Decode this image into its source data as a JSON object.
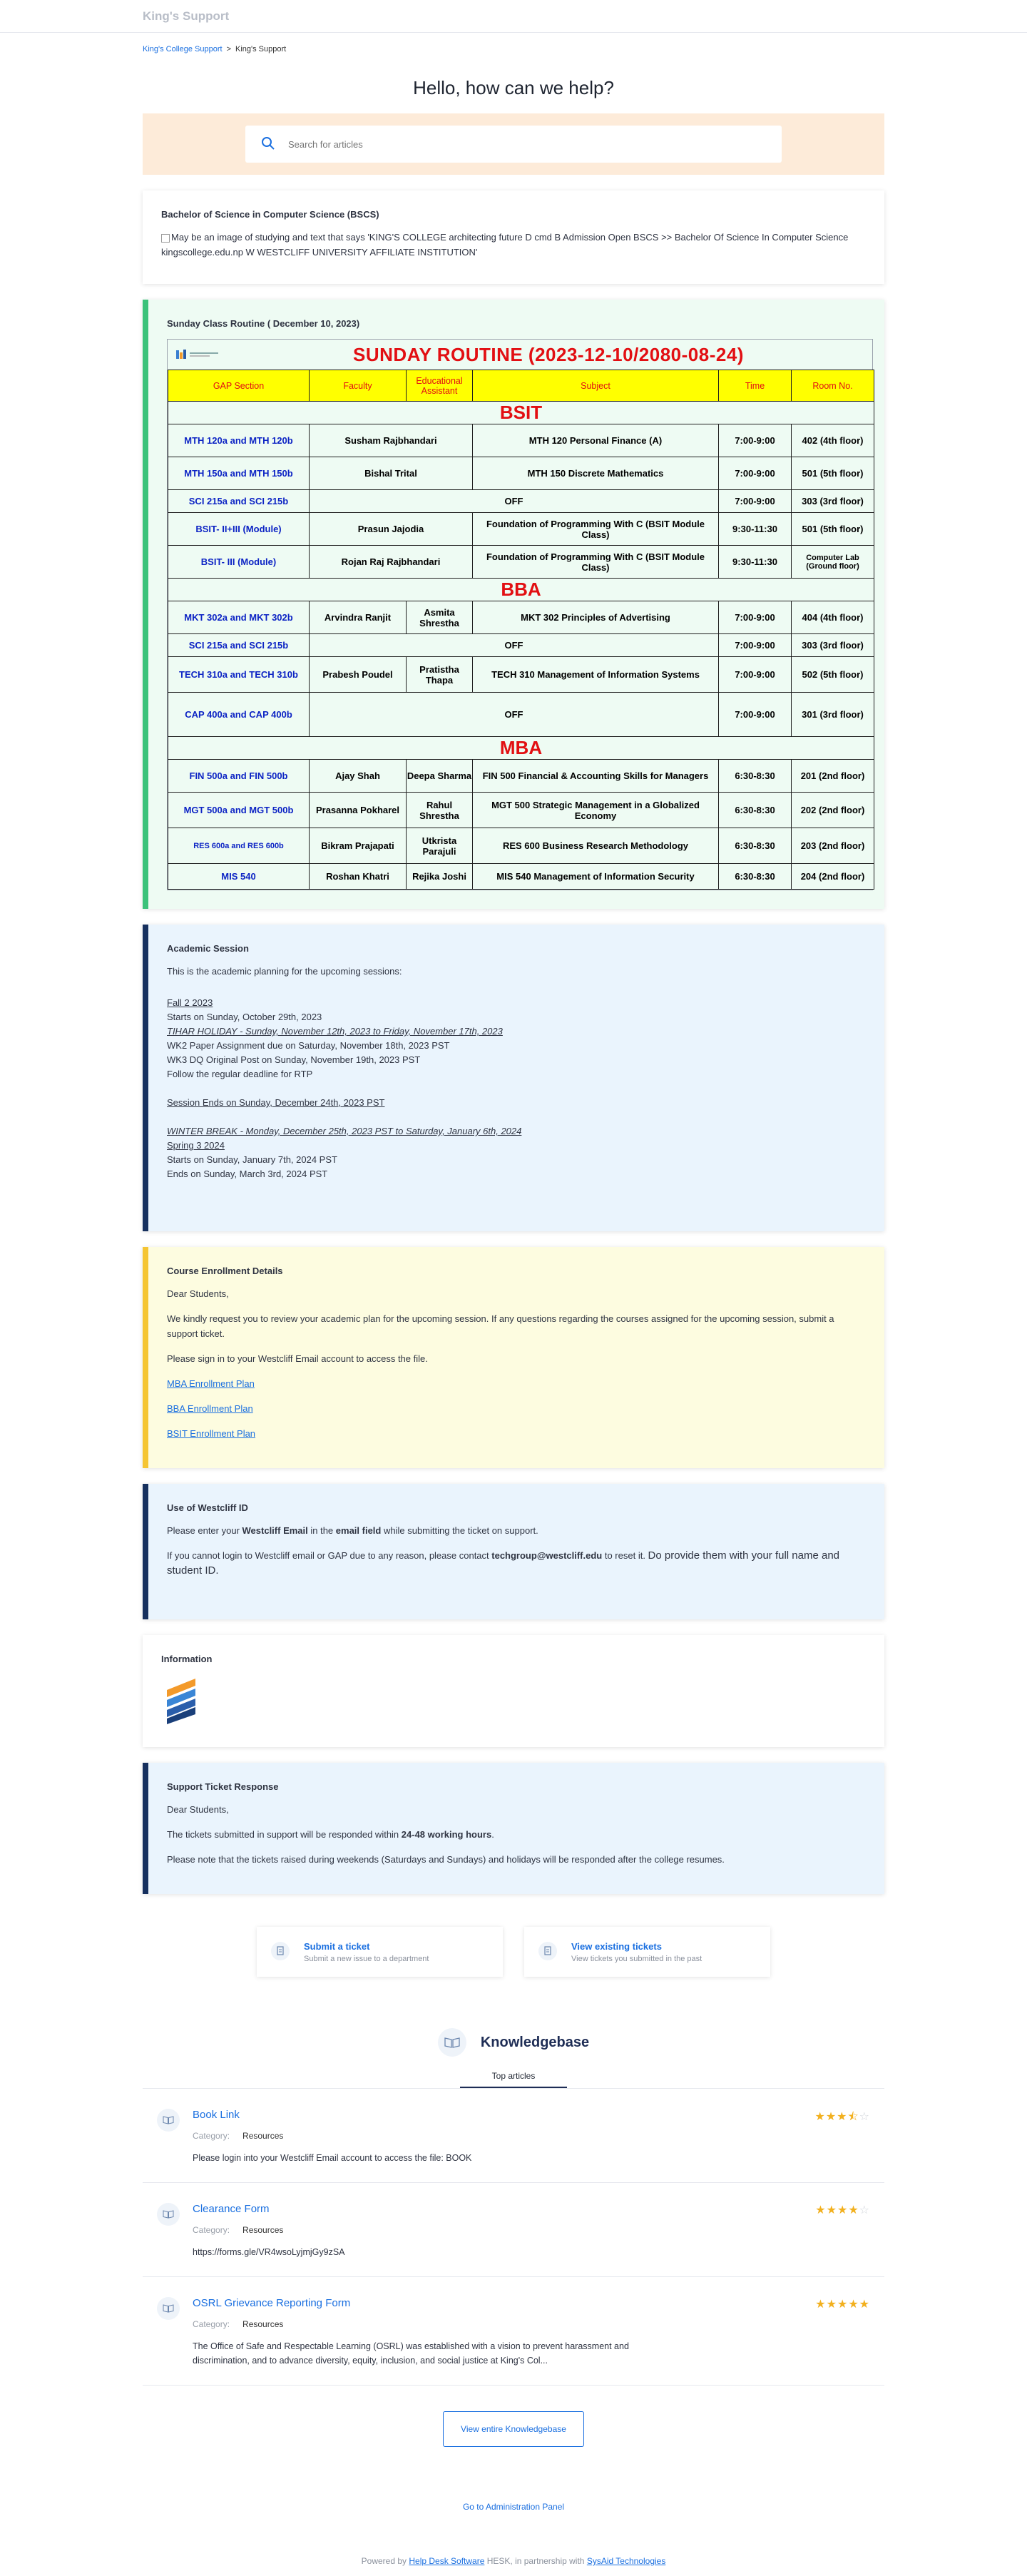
{
  "header": {
    "brand": "King's Support"
  },
  "breadcrumb": {
    "parent": "King's College Support",
    "separator": ">",
    "current": "King's Support"
  },
  "hero": {
    "title": "Hello, how can we help?"
  },
  "search": {
    "placeholder": "Search for articles"
  },
  "bscs": {
    "title": "Bachelor of Science in Computer Science (BSCS)",
    "image_alt": "May be an image of studying and text that says 'KING'S COLLEGE architecting future D cmd B Admission Open BSCS >> Bachelor Of Science In Computer Science kingscollege.edu.np W WESTCLIFF UNIVERSITY AFFILIATE INSTITUTION'"
  },
  "routine": {
    "card_title": "Sunday Class Routine ( December 10, 2023)",
    "banner": "SUNDAY  ROUTINE (2023-12-10/2080-08-24)",
    "headers": [
      "GAP Section",
      "Faculty",
      "Educational Assistant",
      "Subject",
      "Time",
      "Room No."
    ],
    "sections": {
      "bsit": "BSIT",
      "bba": "BBA",
      "mba": "MBA"
    },
    "rows": [
      [
        "MTH 120a and MTH 120b",
        "Susham Rajbhandari",
        "MTH 120 Personal Finance (A)",
        "7:00-9:00",
        "402 (4th floor)"
      ],
      [
        "MTH 150a and MTH 150b",
        "Bishal Trital",
        "MTH 150 Discrete Mathematics",
        "7:00-9:00",
        "501 (5th floor)"
      ],
      [
        "SCI 215a and SCI 215b",
        "OFF",
        "7:00-9:00",
        "303 (3rd floor)"
      ],
      [
        "BSIT-  II+III (Module)",
        "Prasun Jajodia",
        "Foundation of Programming With C (BSIT Module Class)",
        "9:30-11:30",
        "501 (5th floor)"
      ],
      [
        "BSIT-  III (Module)",
        "Rojan Raj Rajbhandari",
        "Foundation of Programming With C (BSIT Module Class)",
        "9:30-11:30",
        "Computer Lab (Ground  floor)"
      ],
      [
        "MKT 302a and MKT 302b",
        "Arvindra Ranjit",
        "Asmita Shrestha",
        "MKT 302 Principles of Advertising",
        "7:00-9:00",
        "404 (4th floor)"
      ],
      [
        "SCI 215a and SCI 215b",
        "OFF",
        "7:00-9:00",
        "303 (3rd floor)"
      ],
      [
        "TECH 310a and TECH 310b",
        "Prabesh Poudel",
        "Pratistha Thapa",
        "TECH 310 Management of Information Systems",
        "7:00-9:00",
        "502 (5th floor)"
      ],
      [
        "CAP 400a and CAP 400b",
        "OFF",
        "7:00-9:00",
        "301 (3rd floor)"
      ],
      [
        "FIN 500a and  FIN 500b",
        "Ajay Shah",
        "Deepa Sharma",
        "FIN 500 Financial & Accounting Skills for Managers",
        "6:30-8:30",
        "201 (2nd floor)"
      ],
      [
        "MGT 500a and  MGT 500b",
        "Prasanna Pokharel",
        "Rahul Shrestha",
        "MGT 500 Strategic Management in a Globalized Economy",
        "6:30-8:30",
        "202 (2nd floor)"
      ],
      [
        "RES 600a and RES 600b",
        "Bikram Prajapati",
        "Utkrista Parajuli",
        "RES 600 Business Research Methodology",
        "6:30-8:30",
        "203 (2nd floor)"
      ],
      [
        "MIS 540",
        "Roshan Khatri",
        "Rejika Joshi",
        "MIS 540 Management of Information Security",
        "6:30-8:30",
        "204 (2nd floor)"
      ]
    ]
  },
  "academic": {
    "title": "Academic Session",
    "intro": "This is the academic planning for the upcoming sessions:",
    "fall_title": "Fall 2 2023",
    "fall_start": "Starts on Sunday, October 29th, 2023",
    "tihar": "TIHAR HOLIDAY - Sunday, November 12th, 2023 to Friday, November 17th, 2023",
    "wk2": "WK2 Paper Assignment due on Saturday, November 18th, 2023 PST",
    "wk3": "WK3 DQ Original Post on Sunday, November 19th, 2023 PST",
    "follow": "Follow the regular deadline for RTP",
    "session_end": "Session Ends on Sunday, December 24th, 2023 PST",
    "winter": "WINTER BREAK - Monday, December 25th, 2023 PST to Saturday, January 6th, 2024",
    "spring_title": "Spring 3 2024",
    "spring_start": "Starts on Sunday, January 7th, 2024 PST",
    "spring_end": "Ends on Sunday, March 3rd, 2024 PST"
  },
  "enrollment": {
    "title": "Course Enrollment Details",
    "greeting": "Dear Students,",
    "para1": "We kindly request you to review your academic plan for the upcoming session. If any questions regarding the courses assigned for the upcoming session, submit a support ticket.",
    "para2": "Please sign in to your Westcliff Email account to access the file.",
    "links": [
      "MBA Enrollment Plan",
      "BBA Enrollment Plan",
      "BSIT Enrollment Plan"
    ]
  },
  "westcliff": {
    "title": "Use of Westcliff ID",
    "p1_a": "Please enter your ",
    "p1_b": "Westcliff Email",
    "p1_c": " in the ",
    "p1_d": "email field",
    "p1_e": " while submitting the ticket on support.",
    "p2_a": "If you cannot login to Westcliff email or GAP due to any reason, please contact ",
    "p2_b": "techgroup@westcliff.edu",
    "p2_c": " to reset it. ",
    "p2_d": "Do provide them with your full name and student ID."
  },
  "information": {
    "title": "Information"
  },
  "ticket_response": {
    "title": "Support Ticket Response",
    "greeting": "Dear Students,",
    "p1_a": "The tickets submitted in support will be responded within ",
    "p1_b": "24-48 working hours",
    "p1_c": ".",
    "p2": "Please note that the tickets raised during weekends (Saturdays and Sundays) and holidays will be responded after the college resumes."
  },
  "actions": [
    {
      "title": "Submit a ticket",
      "desc": "Submit a new issue to a department"
    },
    {
      "title": "View existing tickets",
      "desc": "View tickets you submitted in the past"
    }
  ],
  "kb": {
    "title": "Knowledgebase",
    "tab": "Top articles",
    "category_label": "Category:",
    "articles": [
      {
        "title": "Book Link",
        "category": "Resources",
        "desc": "Please login into your Westcliff Email account to access the file: BOOK",
        "rating": 3.5
      },
      {
        "title": "Clearance Form",
        "category": "Resources",
        "desc": "https://forms.gle/VR4wsoLyjmjGy9zSA",
        "rating": 4
      },
      {
        "title": "OSRL Grievance Reporting Form",
        "category": "Resources",
        "desc": "The Office of Safe and Respectable Learning (OSRL) was established with a vision to prevent harassment and discrimination, and to advance diversity, equity, inclusion, and social justice at King's Col...",
        "rating": 5
      }
    ],
    "view_all": "View entire Knowledgebase"
  },
  "admin_link": "Go to Administration Panel",
  "footer": {
    "prefix": "Powered by ",
    "hesk_link": "Help Desk Software",
    "middle": " HESK, in partnership with ",
    "sysaid_link": "SysAid Technologies"
  },
  "colors": {
    "accent": "#1a6fe0",
    "routine_red": "#e20f12",
    "routine_blue": "#0c23c4",
    "header_yellow": "#ffff00",
    "search_band": "#fdebd9"
  },
  "icons": [
    "search-icon",
    "ticket-icon",
    "book-icon",
    "star-icon"
  ]
}
